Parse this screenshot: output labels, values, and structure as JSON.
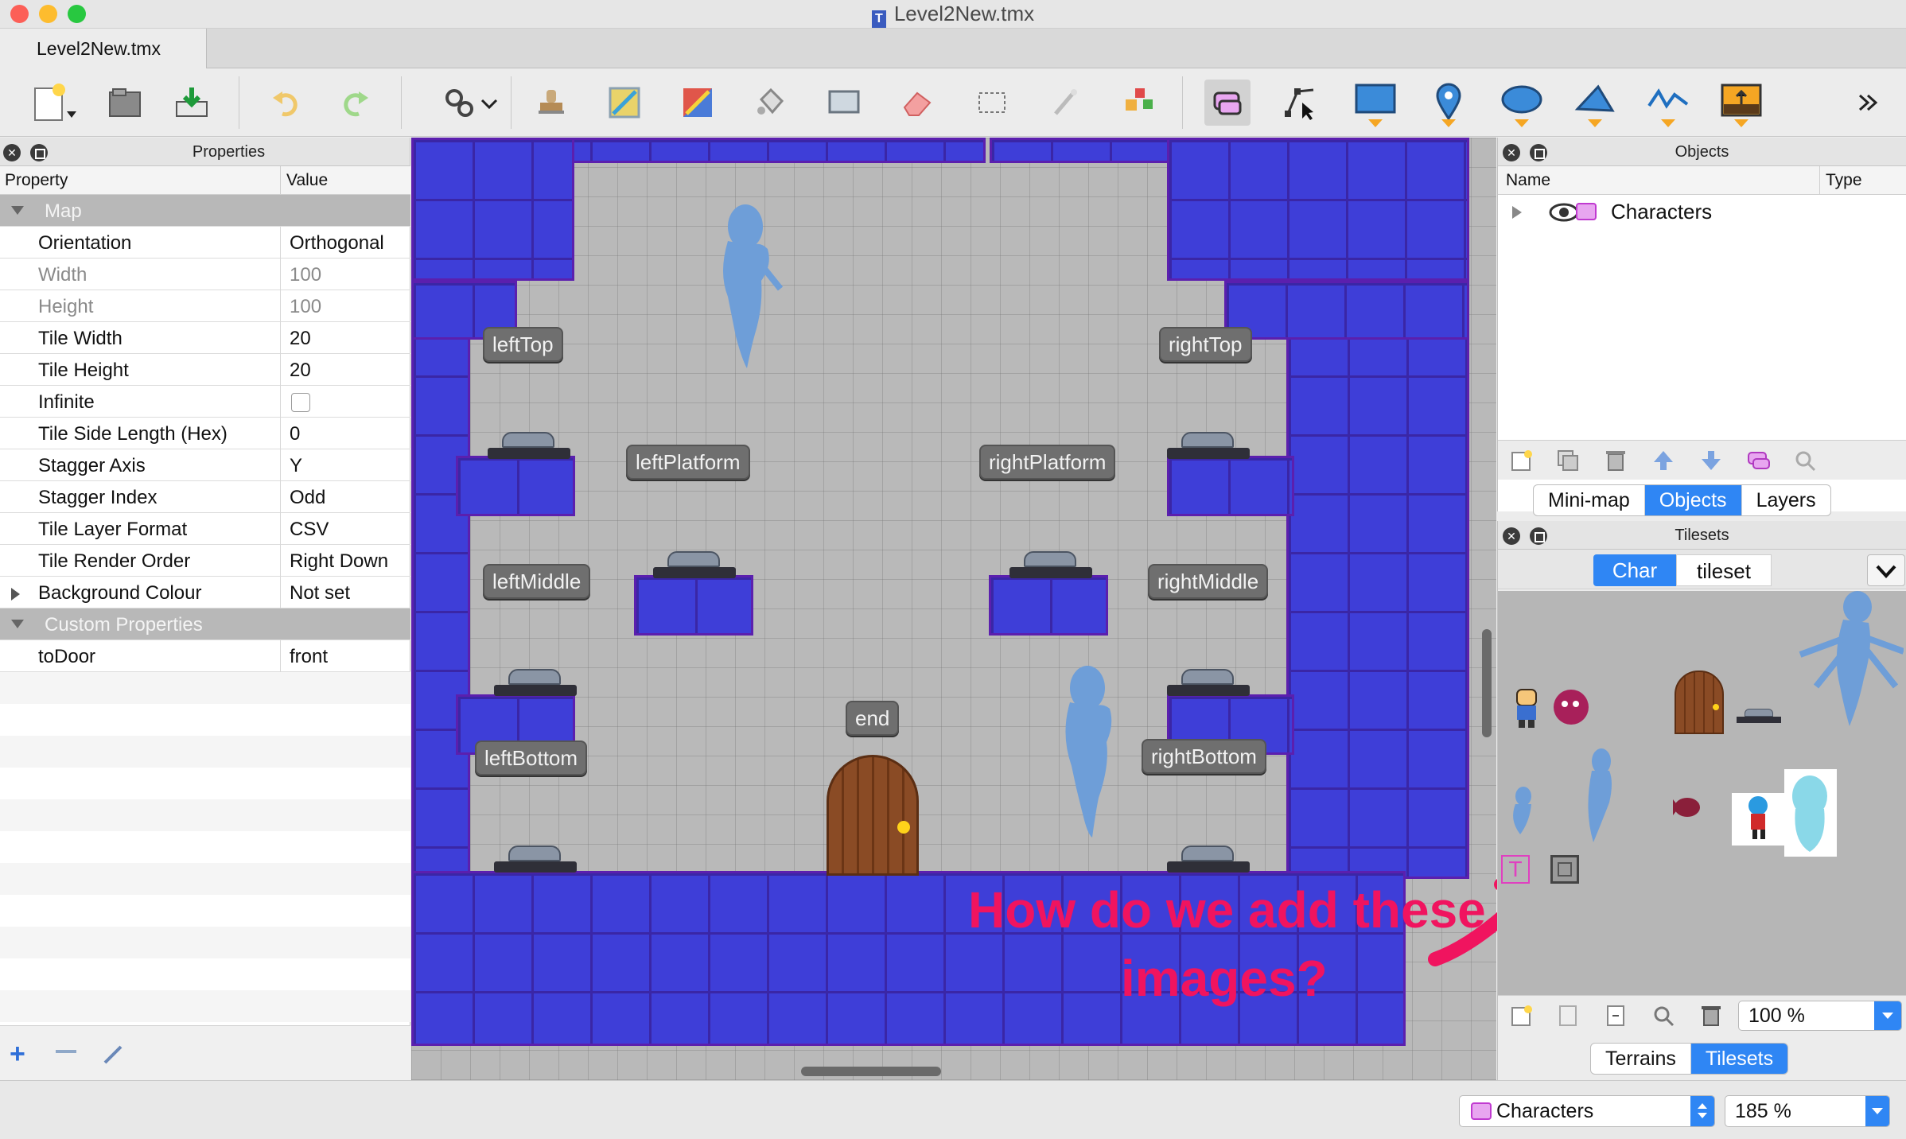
{
  "window": {
    "title": "Level2New.tmx",
    "tab": "Level2New.tmx"
  },
  "colors": {
    "accent": "#2f86f4",
    "wall": "#3e3ed8",
    "annotation": "#f0145f",
    "group_row": "#b8b8b8"
  },
  "toolbar": {
    "icons": [
      "new-map-icon",
      "open-icon",
      "save-icon",
      "undo-icon",
      "redo-icon",
      "commands-icon",
      "stamp-brush-icon",
      "terrain-brush-icon",
      "random-mode-icon",
      "bucket-fill-icon",
      "shape-fill-icon",
      "eraser-icon",
      "rect-select-icon",
      "magic-wand-icon",
      "select-same-tile-icon",
      "select-objects-icon",
      "edit-polygons-icon",
      "insert-rectangle-icon",
      "insert-point-icon",
      "insert-ellipse-icon",
      "insert-polygon-icon",
      "insert-polyline-icon",
      "insert-tile-icon",
      "overflow-icon"
    ]
  },
  "properties": {
    "title": "Properties",
    "col_property": "Property",
    "col_value": "Value",
    "group_map": "Map",
    "rows": [
      {
        "key": "Orientation",
        "value": "Orthogonal"
      },
      {
        "key": "Width",
        "value": "100"
      },
      {
        "key": "Height",
        "value": "100"
      },
      {
        "key": "Tile Width",
        "value": "20"
      },
      {
        "key": "Tile Height",
        "value": "20"
      },
      {
        "key": "Infinite",
        "value": ""
      },
      {
        "key": "Tile Side Length (Hex)",
        "value": "0"
      },
      {
        "key": "Stagger Axis",
        "value": "Y"
      },
      {
        "key": "Stagger Index",
        "value": "Odd"
      },
      {
        "key": "Tile Layer Format",
        "value": "CSV"
      },
      {
        "key": "Tile Render Order",
        "value": "Right Down"
      },
      {
        "key": "Background Colour",
        "value": "Not set"
      }
    ],
    "group_custom": "Custom Properties",
    "custom_rows": [
      {
        "key": "toDoor",
        "value": "front"
      }
    ]
  },
  "map": {
    "labels": {
      "leftTop": "leftTop",
      "rightTop": "rightTop",
      "leftPlatform": "leftPlatform",
      "rightPlatform": "rightPlatform",
      "leftMiddle": "leftMiddle",
      "rightMiddle": "rightMiddle",
      "leftBottom": "leftBottom",
      "rightBottom": "rightBottom",
      "end": "end"
    },
    "annotation_line1": "How do we add these",
    "annotation_line2": "images?"
  },
  "objects": {
    "title": "Objects",
    "col_name": "Name",
    "col_type": "Type",
    "layer": "Characters",
    "tabs": [
      "Mini-map",
      "Objects",
      "Layers"
    ],
    "active_tab": "Objects"
  },
  "tilesets": {
    "title": "Tilesets",
    "tabs": [
      "Char",
      "tileset"
    ],
    "active_tab": "Char",
    "zoom": "100 %",
    "bottom_tabs": [
      "Terrains",
      "Tilesets"
    ],
    "active_bottom": "Tilesets"
  },
  "status": {
    "layer": "Characters",
    "zoom": "185 %"
  }
}
